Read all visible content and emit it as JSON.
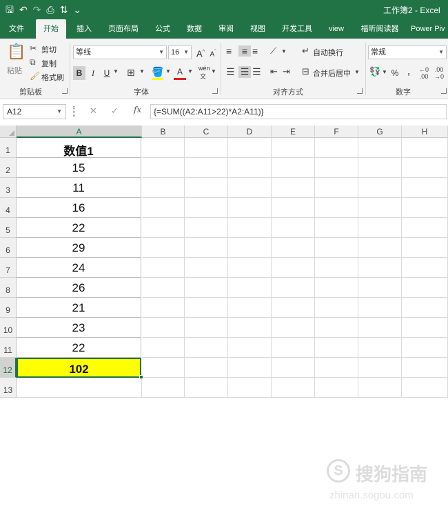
{
  "window": {
    "title": "工作簿2  -  Excel"
  },
  "ribbon_tabs": [
    {
      "label": "文件",
      "active": false
    },
    {
      "label": "开始",
      "active": true
    },
    {
      "label": "插入",
      "active": false
    },
    {
      "label": "页面布局",
      "active": false
    },
    {
      "label": "公式",
      "active": false
    },
    {
      "label": "数据",
      "active": false
    },
    {
      "label": "审阅",
      "active": false
    },
    {
      "label": "视图",
      "active": false
    },
    {
      "label": "开发工具",
      "active": false
    },
    {
      "label": "view",
      "active": false
    },
    {
      "label": "福昕阅读器",
      "active": false
    },
    {
      "label": "Power Piv",
      "active": false
    }
  ],
  "clipboard": {
    "paste_label": "粘贴",
    "cut_label": "剪切",
    "copy_label": "复制",
    "format_painter_label": "格式刷",
    "group_label": "剪贴板"
  },
  "font": {
    "font_name": "等线",
    "font_size": "16",
    "grow_label": "A",
    "shrink_label": "A",
    "bold_label": "B",
    "italic_label": "I",
    "underline_label": "U",
    "font_color_label": "A",
    "phonetic_label": "wén",
    "group_label": "字体"
  },
  "alignment": {
    "wrap_label": "自动换行",
    "merge_label": "合并后居中",
    "group_label": "对齐方式"
  },
  "number": {
    "format": "常规",
    "percent_label": "%",
    "comma_label": ",",
    "group_label": "数字"
  },
  "formula_bar": {
    "name_box": "A12",
    "cancel_glyph": "✕",
    "enter_glyph": "✓",
    "fx_label": "fx",
    "formula": "{=SUM((A2:A11>22)*A2:A11)}"
  },
  "grid": {
    "columns": [
      "A",
      "B",
      "C",
      "D",
      "E",
      "F",
      "G",
      "H"
    ],
    "selected_column": "A",
    "rows": [
      "1",
      "2",
      "3",
      "4",
      "5",
      "6",
      "7",
      "8",
      "9",
      "10",
      "11",
      "12",
      "13"
    ],
    "selected_row": "12",
    "colA_values": [
      "数值1",
      "15",
      "11",
      "16",
      "22",
      "29",
      "24",
      "26",
      "21",
      "23",
      "22",
      "102"
    ],
    "total_fill_color": "#ffff00",
    "selection_color": "#217346"
  },
  "watermark": {
    "logo_glyph": "S",
    "text": "搜狗指南",
    "url": "zhinan.sogou.com"
  },
  "colors": {
    "excel_green": "#217346",
    "ribbon_bg": "#f3f3f3"
  }
}
